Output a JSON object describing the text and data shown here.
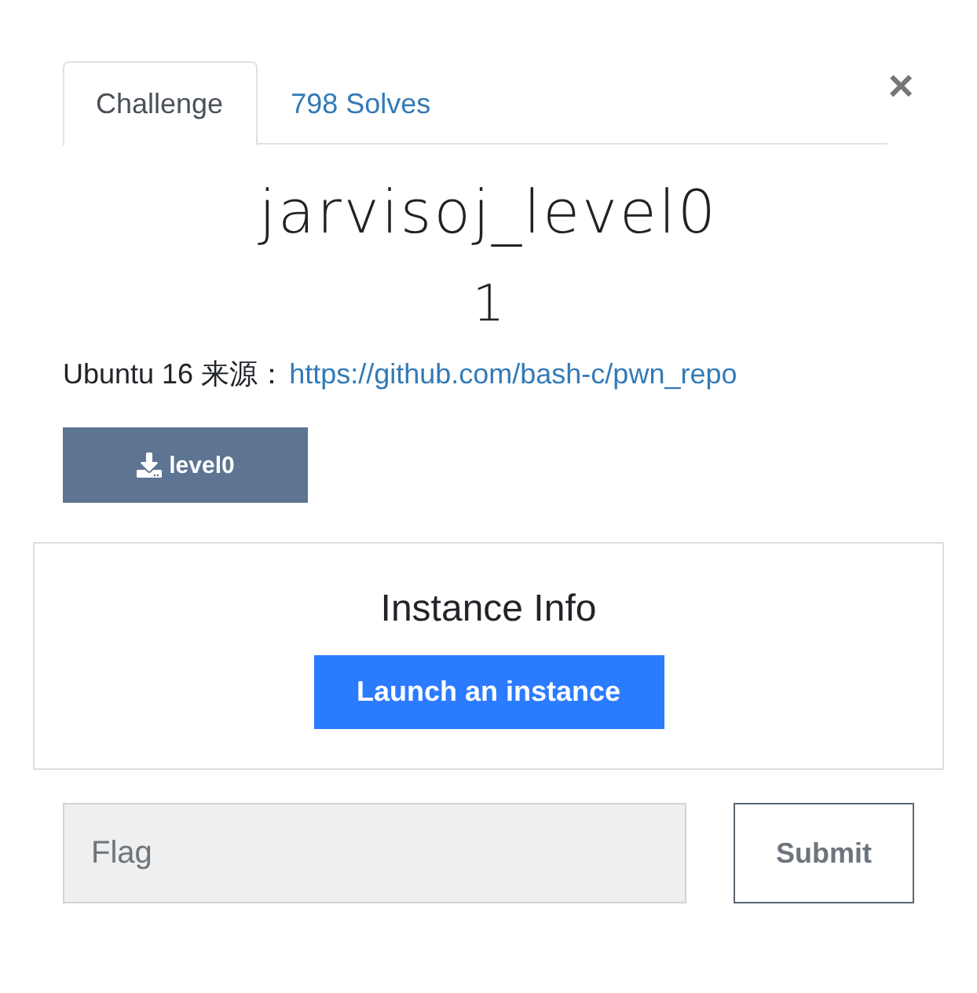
{
  "tabs": [
    {
      "label": "Challenge",
      "selected": true
    },
    {
      "label": "798 Solves",
      "selected": false
    }
  ],
  "close": {
    "label": "×"
  },
  "challenge": {
    "name": "jarvisoj_level0",
    "value": "1",
    "description": {
      "text": "Ubuntu 16 来源：",
      "link": "https://github.com/bash-c/pwn_repo"
    }
  },
  "files": [
    {
      "label": "level0"
    }
  ],
  "instance": {
    "title": "Instance Info",
    "button": "Launch an instance"
  },
  "flag_form": {
    "placeholder": "Flag",
    "submit": "Submit"
  }
}
